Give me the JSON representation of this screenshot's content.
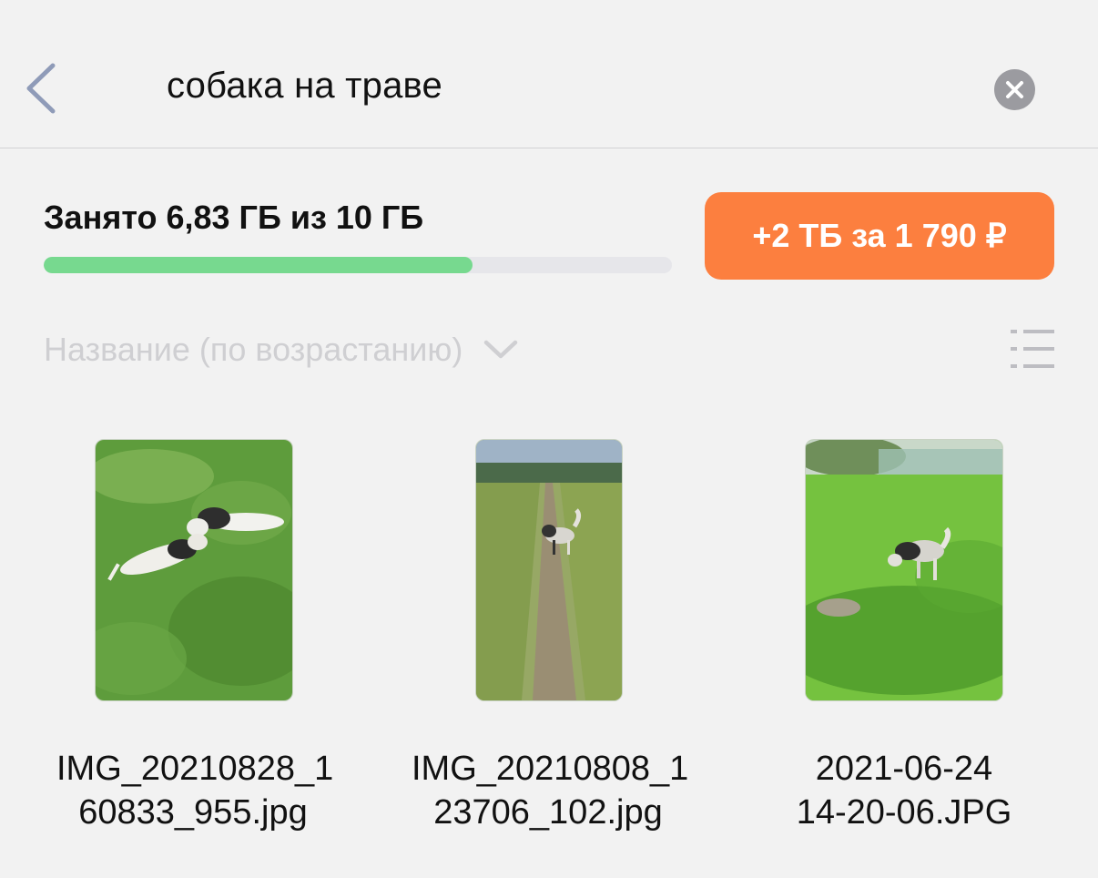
{
  "header": {
    "search_query": "собака на траве",
    "back_icon": "chevron-left-icon",
    "clear_icon": "close-circle-icon"
  },
  "storage": {
    "label": "Занято 6,83 ГБ из 10 ГБ",
    "used_fraction": 0.683,
    "bar_color": "#77d98f",
    "upgrade_label": "+2 ТБ за 1 790 ₽",
    "upgrade_color": "#fc7f3f"
  },
  "sort": {
    "label": "Название (по возрастанию)",
    "chevron_icon": "chevron-down-icon",
    "view_toggle_icon": "list-view-icon"
  },
  "files": [
    {
      "name_line1": "IMG_20210828_1",
      "name_line2": "60833_955.jpg"
    },
    {
      "name_line1": "IMG_20210808_1",
      "name_line2": "23706_102.jpg"
    },
    {
      "name_line1": "2021-06-24",
      "name_line2": "14-20-06.JPG"
    }
  ]
}
